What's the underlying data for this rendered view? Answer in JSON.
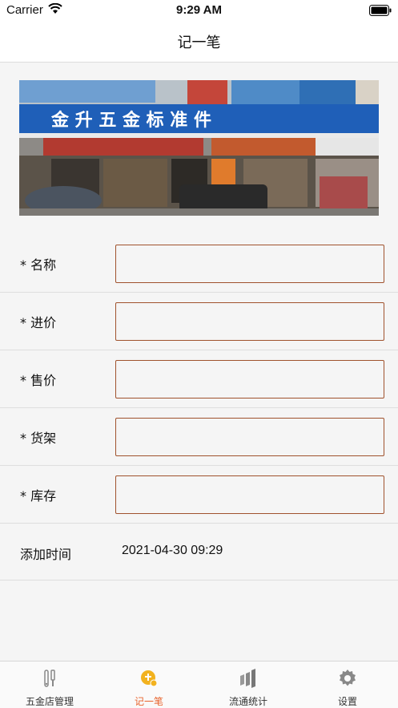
{
  "status_bar": {
    "carrier": "Carrier",
    "time": "9:29 AM"
  },
  "nav": {
    "title": "记一笔"
  },
  "banner": {
    "sign_text": "金 升 五 金 标 准 件",
    "alt": "五金店照片"
  },
  "form": {
    "fields": [
      {
        "label": "* 名称",
        "value": ""
      },
      {
        "label": "* 进价",
        "value": ""
      },
      {
        "label": "* 售价",
        "value": ""
      },
      {
        "label": "* 货架",
        "value": ""
      },
      {
        "label": "* 库存",
        "value": ""
      }
    ],
    "added_time_label": "添加时间",
    "added_time_value": "2021-04-30 09:29"
  },
  "tabs": [
    {
      "label": "五金店管理",
      "icon": "tools-icon",
      "active": false
    },
    {
      "label": "记一笔",
      "icon": "record-icon",
      "active": true
    },
    {
      "label": "流通统计",
      "icon": "stats-icon",
      "active": false
    },
    {
      "label": "设置",
      "icon": "gear-icon",
      "active": false
    }
  ],
  "colors": {
    "accent": "#e8632c",
    "input_border": "#a0522d"
  }
}
